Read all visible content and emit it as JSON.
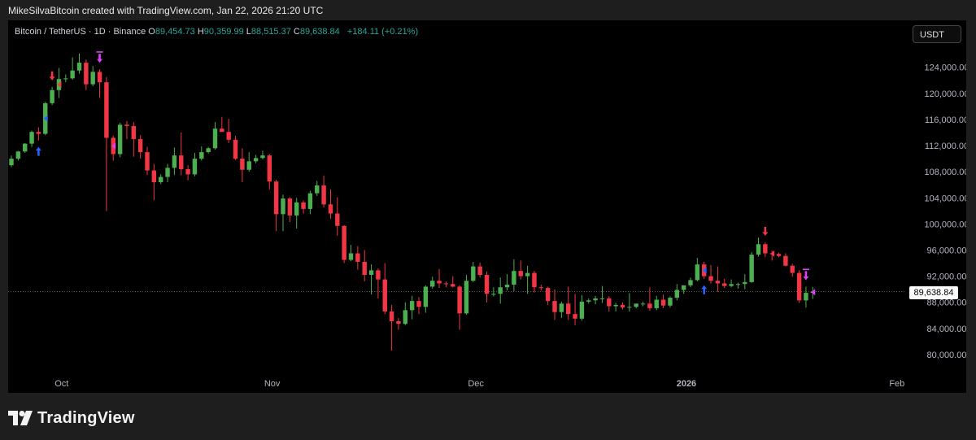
{
  "caption": "MikeSilvaBitcoin created with TradingView.com, Jan 22, 2026 21:20 UTC",
  "legend": {
    "symbol": "Bitcoin / TetherUS · 1D · Binance",
    "o_label": "O",
    "o_value": "89,454.73",
    "h_label": "H",
    "h_value": "90,359.99",
    "l_label": "L",
    "l_value": "88,515.37",
    "c_label": "C",
    "c_value": "89,638.84",
    "change": "+184.11 (+0.21%)"
  },
  "currency": "USDT",
  "brand": {
    "name": "TradingView"
  },
  "colors": {
    "up": "#4caf50",
    "down": "#f23645",
    "arrow_blue": "#2962ff",
    "arrow_red": "#f23645",
    "arrow_magenta": "#e040fb",
    "axis_text": "#b2b5be"
  },
  "chart_data": {
    "type": "candlestick",
    "title": "Bitcoin / TetherUS · 1D · Binance",
    "ylim": [
      77000,
      128700
    ],
    "y_ticks": [
      80000,
      84000,
      88000,
      92000,
      96000,
      100000,
      104000,
      108000,
      112000,
      116000,
      120000,
      124000
    ],
    "y_tick_labels": [
      "80,000.00",
      "84,000.00",
      "88,000.00",
      "92,000.00",
      "96,000.00",
      "100,000.00",
      "104,000.00",
      "108,000.00",
      "112,000.00",
      "116,000.00",
      "120,000.00",
      "124,000.00"
    ],
    "x_range": [
      "2025-09-26",
      "2026-02-06"
    ],
    "x_ticks": [
      {
        "date": "2025-10-01",
        "label": "Oct"
      },
      {
        "date": "2025-11-01",
        "label": "Nov"
      },
      {
        "date": "2025-12-01",
        "label": "Dec"
      },
      {
        "date": "2026-01-01",
        "label": "2026"
      },
      {
        "date": "2026-02-01",
        "label": "Feb"
      }
    ],
    "last_price": 89638.84,
    "last_price_label": "89,638.84",
    "grid": false,
    "candles": [
      {
        "d": "2025-09-26",
        "o": 109000,
        "h": 110500,
        "l": 108700,
        "c": 110000
      },
      {
        "d": "2025-09-27",
        "o": 110000,
        "h": 111200,
        "l": 109700,
        "c": 111100
      },
      {
        "d": "2025-09-28",
        "o": 111100,
        "h": 112400,
        "l": 110900,
        "c": 112300
      },
      {
        "d": "2025-09-29",
        "o": 112300,
        "h": 114300,
        "l": 111800,
        "c": 114100
      },
      {
        "d": "2025-09-30",
        "o": 114100,
        "h": 114800,
        "l": 112800,
        "c": 113800
      },
      {
        "d": "2025-10-01",
        "o": 113800,
        "h": 118700,
        "l": 113600,
        "c": 118500
      },
      {
        "d": "2025-10-02",
        "o": 118500,
        "h": 121000,
        "l": 118200,
        "c": 120500
      },
      {
        "d": "2025-10-03",
        "o": 120500,
        "h": 123900,
        "l": 119300,
        "c": 122200
      },
      {
        "d": "2025-10-04",
        "o": 122200,
        "h": 122900,
        "l": 121700,
        "c": 122300
      },
      {
        "d": "2025-10-05",
        "o": 122300,
        "h": 125500,
        "l": 122100,
        "c": 123500
      },
      {
        "d": "2025-10-06",
        "o": 123500,
        "h": 126100,
        "l": 123000,
        "c": 124700
      },
      {
        "d": "2025-10-07",
        "o": 124700,
        "h": 125200,
        "l": 120500,
        "c": 121400
      },
      {
        "d": "2025-10-08",
        "o": 121400,
        "h": 124200,
        "l": 121100,
        "c": 123300
      },
      {
        "d": "2025-10-09",
        "o": 123300,
        "h": 123700,
        "l": 119300,
        "c": 121700
      },
      {
        "d": "2025-10-10",
        "o": 121700,
        "h": 122500,
        "l": 102000,
        "c": 113200
      },
      {
        "d": "2025-10-11",
        "o": 113200,
        "h": 113500,
        "l": 109700,
        "c": 110700
      },
      {
        "d": "2025-10-12",
        "o": 110700,
        "h": 115500,
        "l": 110200,
        "c": 115200
      },
      {
        "d": "2025-10-13",
        "o": 115200,
        "h": 115800,
        "l": 113000,
        "c": 115000
      },
      {
        "d": "2025-10-14",
        "o": 115000,
        "h": 115600,
        "l": 110300,
        "c": 113000
      },
      {
        "d": "2025-10-15",
        "o": 113000,
        "h": 113600,
        "l": 110000,
        "c": 111000
      },
      {
        "d": "2025-10-16",
        "o": 111000,
        "h": 111800,
        "l": 107500,
        "c": 108200
      },
      {
        "d": "2025-10-17",
        "o": 108200,
        "h": 109200,
        "l": 103600,
        "c": 106400
      },
      {
        "d": "2025-10-18",
        "o": 106400,
        "h": 107600,
        "l": 106100,
        "c": 107200
      },
      {
        "d": "2025-10-19",
        "o": 107200,
        "h": 109200,
        "l": 106400,
        "c": 108600
      },
      {
        "d": "2025-10-20",
        "o": 108600,
        "h": 111700,
        "l": 107500,
        "c": 110500
      },
      {
        "d": "2025-10-21",
        "o": 110500,
        "h": 114000,
        "l": 107500,
        "c": 108400
      },
      {
        "d": "2025-10-22",
        "o": 108400,
        "h": 109000,
        "l": 106700,
        "c": 107600
      },
      {
        "d": "2025-10-23",
        "o": 107600,
        "h": 110900,
        "l": 107300,
        "c": 110000
      },
      {
        "d": "2025-10-24",
        "o": 110000,
        "h": 111900,
        "l": 109700,
        "c": 111000
      },
      {
        "d": "2025-10-25",
        "o": 111000,
        "h": 111800,
        "l": 110800,
        "c": 111600
      },
      {
        "d": "2025-10-26",
        "o": 111600,
        "h": 115600,
        "l": 111400,
        "c": 114600
      },
      {
        "d": "2025-10-27",
        "o": 114600,
        "h": 116400,
        "l": 114200,
        "c": 114100
      },
      {
        "d": "2025-10-28",
        "o": 114100,
        "h": 116100,
        "l": 112400,
        "c": 112900
      },
      {
        "d": "2025-10-29",
        "o": 112900,
        "h": 113500,
        "l": 109800,
        "c": 110000
      },
      {
        "d": "2025-10-30",
        "o": 110000,
        "h": 111600,
        "l": 106400,
        "c": 108300
      },
      {
        "d": "2025-10-31",
        "o": 108300,
        "h": 111000,
        "l": 108000,
        "c": 109600
      },
      {
        "d": "2025-11-01",
        "o": 109600,
        "h": 110600,
        "l": 109300,
        "c": 110100
      },
      {
        "d": "2025-11-02",
        "o": 110100,
        "h": 111200,
        "l": 109900,
        "c": 110500
      },
      {
        "d": "2025-11-03",
        "o": 110500,
        "h": 110700,
        "l": 105300,
        "c": 106500
      },
      {
        "d": "2025-11-04",
        "o": 106500,
        "h": 106800,
        "l": 98900,
        "c": 101500
      },
      {
        "d": "2025-11-05",
        "o": 101500,
        "h": 104500,
        "l": 98900,
        "c": 103900
      },
      {
        "d": "2025-11-06",
        "o": 103900,
        "h": 104100,
        "l": 100300,
        "c": 101300
      },
      {
        "d": "2025-11-07",
        "o": 101300,
        "h": 104000,
        "l": 99300,
        "c": 103300
      },
      {
        "d": "2025-11-08",
        "o": 103300,
        "h": 103600,
        "l": 101600,
        "c": 102300
      },
      {
        "d": "2025-11-09",
        "o": 102300,
        "h": 105100,
        "l": 101500,
        "c": 104700
      },
      {
        "d": "2025-11-10",
        "o": 104700,
        "h": 106600,
        "l": 104300,
        "c": 105900
      },
      {
        "d": "2025-11-11",
        "o": 105900,
        "h": 107400,
        "l": 102500,
        "c": 103000
      },
      {
        "d": "2025-11-12",
        "o": 103000,
        "h": 105300,
        "l": 100800,
        "c": 101600
      },
      {
        "d": "2025-11-13",
        "o": 101600,
        "h": 104100,
        "l": 98200,
        "c": 99700
      },
      {
        "d": "2025-11-14",
        "o": 99700,
        "h": 99800,
        "l": 94000,
        "c": 94500
      },
      {
        "d": "2025-11-15",
        "o": 94500,
        "h": 96800,
        "l": 94300,
        "c": 95500
      },
      {
        "d": "2025-11-16",
        "o": 95500,
        "h": 96600,
        "l": 93000,
        "c": 94200
      },
      {
        "d": "2025-11-17",
        "o": 94200,
        "h": 96000,
        "l": 91200,
        "c": 92200
      },
      {
        "d": "2025-11-18",
        "o": 92200,
        "h": 93800,
        "l": 89200,
        "c": 92900
      },
      {
        "d": "2025-11-19",
        "o": 92900,
        "h": 93200,
        "l": 88600,
        "c": 91500
      },
      {
        "d": "2025-11-20",
        "o": 91500,
        "h": 94000,
        "l": 86200,
        "c": 86600
      },
      {
        "d": "2025-11-21",
        "o": 86600,
        "h": 87600,
        "l": 80600,
        "c": 85100
      },
      {
        "d": "2025-11-22",
        "o": 85100,
        "h": 85600,
        "l": 83800,
        "c": 84700
      },
      {
        "d": "2025-11-23",
        "o": 84700,
        "h": 88000,
        "l": 84500,
        "c": 86800
      },
      {
        "d": "2025-11-24",
        "o": 86800,
        "h": 89000,
        "l": 85400,
        "c": 88200
      },
      {
        "d": "2025-11-25",
        "o": 88200,
        "h": 88800,
        "l": 86200,
        "c": 87300
      },
      {
        "d": "2025-11-26",
        "o": 87300,
        "h": 90600,
        "l": 86400,
        "c": 90400
      },
      {
        "d": "2025-11-27",
        "o": 90400,
        "h": 91900,
        "l": 90100,
        "c": 91300
      },
      {
        "d": "2025-11-28",
        "o": 91300,
        "h": 93100,
        "l": 90200,
        "c": 90900
      },
      {
        "d": "2025-11-29",
        "o": 90900,
        "h": 91200,
        "l": 90300,
        "c": 90800
      },
      {
        "d": "2025-11-30",
        "o": 90800,
        "h": 92000,
        "l": 90300,
        "c": 90400
      },
      {
        "d": "2025-12-01",
        "o": 90400,
        "h": 90600,
        "l": 83800,
        "c": 86300
      },
      {
        "d": "2025-12-02",
        "o": 86300,
        "h": 92200,
        "l": 86100,
        "c": 91300
      },
      {
        "d": "2025-12-03",
        "o": 91300,
        "h": 94200,
        "l": 91100,
        "c": 93500
      },
      {
        "d": "2025-12-04",
        "o": 93500,
        "h": 94100,
        "l": 91800,
        "c": 92200
      },
      {
        "d": "2025-12-05",
        "o": 92200,
        "h": 92700,
        "l": 88000,
        "c": 89300
      },
      {
        "d": "2025-12-06",
        "o": 89300,
        "h": 90300,
        "l": 88900,
        "c": 89300
      },
      {
        "d": "2025-12-07",
        "o": 89300,
        "h": 91800,
        "l": 87800,
        "c": 90300
      },
      {
        "d": "2025-12-08",
        "o": 90300,
        "h": 92300,
        "l": 89800,
        "c": 90700
      },
      {
        "d": "2025-12-09",
        "o": 90700,
        "h": 94600,
        "l": 89700,
        "c": 92800
      },
      {
        "d": "2025-12-10",
        "o": 92800,
        "h": 94400,
        "l": 91500,
        "c": 92000
      },
      {
        "d": "2025-12-11",
        "o": 92000,
        "h": 93600,
        "l": 89300,
        "c": 92500
      },
      {
        "d": "2025-12-12",
        "o": 92500,
        "h": 92800,
        "l": 89500,
        "c": 90300
      },
      {
        "d": "2025-12-13",
        "o": 90300,
        "h": 90700,
        "l": 89800,
        "c": 90200
      },
      {
        "d": "2025-12-14",
        "o": 90200,
        "h": 90400,
        "l": 87600,
        "c": 88200
      },
      {
        "d": "2025-12-15",
        "o": 88200,
        "h": 90000,
        "l": 85300,
        "c": 86500
      },
      {
        "d": "2025-12-16",
        "o": 86500,
        "h": 88100,
        "l": 85600,
        "c": 87800
      },
      {
        "d": "2025-12-17",
        "o": 87800,
        "h": 90400,
        "l": 85300,
        "c": 86200
      },
      {
        "d": "2025-12-18",
        "o": 86200,
        "h": 89300,
        "l": 84500,
        "c": 85500
      },
      {
        "d": "2025-12-19",
        "o": 85500,
        "h": 89100,
        "l": 85200,
        "c": 88100
      },
      {
        "d": "2025-12-20",
        "o": 88100,
        "h": 88600,
        "l": 87800,
        "c": 88300
      },
      {
        "d": "2025-12-21",
        "o": 88300,
        "h": 89000,
        "l": 87700,
        "c": 88600
      },
      {
        "d": "2025-12-22",
        "o": 88600,
        "h": 90500,
        "l": 87900,
        "c": 88600
      },
      {
        "d": "2025-12-23",
        "o": 88600,
        "h": 88900,
        "l": 86600,
        "c": 87400
      },
      {
        "d": "2025-12-24",
        "o": 87400,
        "h": 87900,
        "l": 86600,
        "c": 87600
      },
      {
        "d": "2025-12-25",
        "o": 87600,
        "h": 88000,
        "l": 86900,
        "c": 87200
      },
      {
        "d": "2025-12-26",
        "o": 87200,
        "h": 89400,
        "l": 86600,
        "c": 87300
      },
      {
        "d": "2025-12-27",
        "o": 87300,
        "h": 87800,
        "l": 87100,
        "c": 87800
      },
      {
        "d": "2025-12-28",
        "o": 87800,
        "h": 88100,
        "l": 87400,
        "c": 87800
      },
      {
        "d": "2025-12-29",
        "o": 87800,
        "h": 90300,
        "l": 86700,
        "c": 87100
      },
      {
        "d": "2025-12-30",
        "o": 87100,
        "h": 89000,
        "l": 86800,
        "c": 88400
      },
      {
        "d": "2025-12-31",
        "o": 88400,
        "h": 89200,
        "l": 87100,
        "c": 87500
      },
      {
        "d": "2026-01-01",
        "o": 87500,
        "h": 88900,
        "l": 87200,
        "c": 88700
      },
      {
        "d": "2026-01-02",
        "o": 88700,
        "h": 90800,
        "l": 88300,
        "c": 89900
      },
      {
        "d": "2026-01-03",
        "o": 89900,
        "h": 90600,
        "l": 89300,
        "c": 90600
      },
      {
        "d": "2026-01-04",
        "o": 90600,
        "h": 91800,
        "l": 90300,
        "c": 91400
      },
      {
        "d": "2026-01-05",
        "o": 91400,
        "h": 94800,
        "l": 91200,
        "c": 93800
      },
      {
        "d": "2026-01-06",
        "o": 93800,
        "h": 94200,
        "l": 91600,
        "c": 92000
      },
      {
        "d": "2026-01-07",
        "o": 92000,
        "h": 93700,
        "l": 90900,
        "c": 91300
      },
      {
        "d": "2026-01-08",
        "o": 91300,
        "h": 93500,
        "l": 89600,
        "c": 90900
      },
      {
        "d": "2026-01-09",
        "o": 90900,
        "h": 91600,
        "l": 90200,
        "c": 90500
      },
      {
        "d": "2026-01-10",
        "o": 90500,
        "h": 91500,
        "l": 90300,
        "c": 90800
      },
      {
        "d": "2026-01-11",
        "o": 90800,
        "h": 91000,
        "l": 90100,
        "c": 90800
      },
      {
        "d": "2026-01-12",
        "o": 90800,
        "h": 92300,
        "l": 90000,
        "c": 91100
      },
      {
        "d": "2026-01-13",
        "o": 91100,
        "h": 95700,
        "l": 91000,
        "c": 95300
      },
      {
        "d": "2026-01-14",
        "o": 95300,
        "h": 97900,
        "l": 95000,
        "c": 96900
      },
      {
        "d": "2026-01-15",
        "o": 96900,
        "h": 97200,
        "l": 94900,
        "c": 95500
      },
      {
        "d": "2026-01-16",
        "o": 95500,
        "h": 95900,
        "l": 94400,
        "c": 95400
      },
      {
        "d": "2026-01-17",
        "o": 95400,
        "h": 95600,
        "l": 94900,
        "c": 95100
      },
      {
        "d": "2026-01-18",
        "o": 95100,
        "h": 95500,
        "l": 93500,
        "c": 93600
      },
      {
        "d": "2026-01-19",
        "o": 93600,
        "h": 93900,
        "l": 91900,
        "c": 92500
      },
      {
        "d": "2026-01-20",
        "o": 92500,
        "h": 92900,
        "l": 87900,
        "c": 88300
      },
      {
        "d": "2026-01-21",
        "o": 88300,
        "h": 90400,
        "l": 87200,
        "c": 89450
      },
      {
        "d": "2026-01-22",
        "o": 89454.73,
        "h": 90359.99,
        "l": 88515.37,
        "c": 89638.84
      }
    ],
    "markers": [
      {
        "d": "2025-09-30",
        "type": "arrow-up",
        "color": "blue",
        "side": "below"
      },
      {
        "d": "2025-10-01",
        "type": "flag",
        "color": "blue",
        "side": "mid"
      },
      {
        "d": "2025-10-02",
        "type": "arrow-down",
        "color": "red",
        "side": "above"
      },
      {
        "d": "2025-10-03",
        "type": "flag",
        "color": "red",
        "side": "mid"
      },
      {
        "d": "2025-10-09",
        "type": "arrow-down",
        "color": "magenta",
        "side": "above"
      },
      {
        "d": "2025-10-11",
        "type": "flag",
        "color": "magenta",
        "side": "mid"
      },
      {
        "d": "2026-01-06",
        "type": "flag",
        "color": "blue",
        "side": "mid"
      },
      {
        "d": "2026-01-06",
        "type": "arrow-up",
        "color": "blue",
        "side": "below"
      },
      {
        "d": "2026-01-15",
        "type": "arrow-down",
        "color": "red",
        "side": "above"
      },
      {
        "d": "2026-01-16",
        "type": "flag",
        "color": "red",
        "side": "mid"
      },
      {
        "d": "2026-01-21",
        "type": "arrow-down",
        "color": "magenta",
        "side": "above"
      },
      {
        "d": "2026-01-22",
        "type": "flag",
        "color": "magenta",
        "side": "mid"
      }
    ]
  }
}
